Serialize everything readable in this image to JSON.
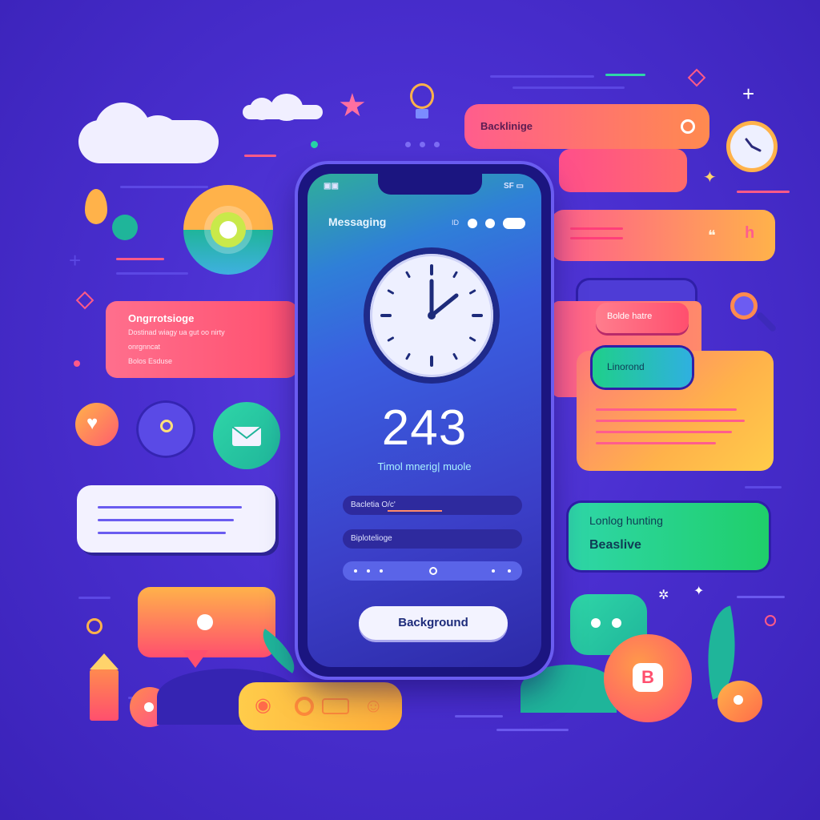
{
  "top_bar": {
    "label": "Backlinige"
  },
  "phone": {
    "status_left": "▣▣",
    "status_right": "SF ▭",
    "app_title": "Messaging",
    "count": "243",
    "subtitle": "Timol mnerig| muole",
    "fields": [
      "Bacletia O/c'",
      "Biplotelioge"
    ],
    "button_label": "Background"
  },
  "left_card": {
    "title": "Ongrrotsioge",
    "lines": [
      "Dostinad wiagy ua gut oo nirty",
      "onrgnncat",
      "Bolos Esduse"
    ]
  },
  "right_cards": {
    "top_pill": "Bolde hatre",
    "green_pill": "Linorond",
    "green_card_title": "Lonlog hunting",
    "green_card_sub": "Beaslive"
  },
  "badge_letter": "B",
  "colors": {
    "background": "#4a2fd0",
    "accent_pink": "#ff4f8b",
    "accent_orange": "#ffb24a",
    "accent_green": "#1fcf8a",
    "phone_dark": "#1b1580"
  }
}
